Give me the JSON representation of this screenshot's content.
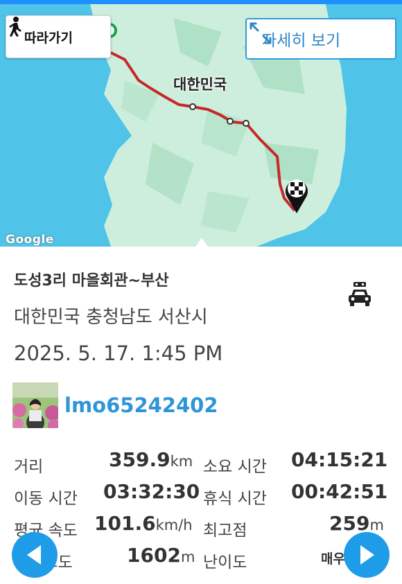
{
  "map": {
    "follow_label": "따라가기",
    "detail_label": "자세히 보기",
    "country_label": "대한민국",
    "google_logo": "Google"
  },
  "route": {
    "title": "도성3리 마을회관~부산",
    "location": "대한민국 충청남도 서산시",
    "datetime": "2025. 5. 17. 1:45 PM",
    "activity_icon": "car-icon"
  },
  "user": {
    "name": "lmo65242402"
  },
  "stats": {
    "distance": {
      "label": "거리",
      "value": "359.9",
      "unit": "km"
    },
    "duration": {
      "label": "소요 시간",
      "value": "04:15:21"
    },
    "moving_time": {
      "label": "이동 시간",
      "value": "03:32:30"
    },
    "rest_time": {
      "label": "휴식 시간",
      "value": "00:42:51"
    },
    "avg_speed": {
      "label": "평균 속도",
      "value": "101.6",
      "unit": "km/h"
    },
    "max_altitude": {
      "label": "최고점",
      "value": "259",
      "unit": "m"
    },
    "total_ascent": {
      "label": "누적고도",
      "value": "1602",
      "unit": "m"
    },
    "difficulty": {
      "label": "난이도",
      "value": "매우"
    }
  },
  "colors": {
    "accent": "#1f9ce8",
    "route": "#c62828",
    "sea": "#4fc3e8",
    "land": "#cdeedd"
  }
}
